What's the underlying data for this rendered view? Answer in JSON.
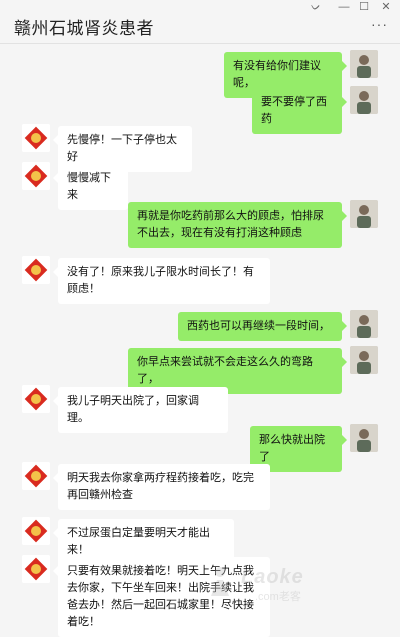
{
  "window": {
    "title": "赣州石城肾炎患者",
    "controls": {
      "pin": "ᨆ",
      "minimize": "—",
      "maximize": "☐",
      "close": "✕"
    },
    "more": "···"
  },
  "colors": {
    "self_bubble": "#95ec69",
    "other_bubble": "#ffffff",
    "background": "#f5f5f5"
  },
  "messages": [
    {
      "side": "right",
      "text": "有没有给你们建议呢，"
    },
    {
      "side": "right",
      "text": "要不要停了西药"
    },
    {
      "side": "left",
      "text": "先慢停！一下子停也太好"
    },
    {
      "side": "left",
      "text": "慢慢减下来"
    },
    {
      "side": "right",
      "text": "再就是你吃药前那么大的顾虑，怕排尿不出去，现在有没有打消这种顾虑"
    },
    {
      "side": "left",
      "text": "没有了！原来我儿子限水时间长了！有顾虑！"
    },
    {
      "side": "right",
      "text": "西药也可以再继续一段时间，"
    },
    {
      "side": "right",
      "text": "你早点来尝试就不会走这么久的弯路了，"
    },
    {
      "side": "left",
      "text": "我儿子明天出院了，回家调理。"
    },
    {
      "side": "right",
      "text": "那么快就出院了"
    },
    {
      "side": "left",
      "text": "明天我去你家拿两疗程药接着吃，吃完再回赣州检查"
    },
    {
      "side": "left",
      "text": "不过尿蛋白定量要明天才能出来！"
    },
    {
      "side": "left",
      "text": "只要有效果就接着吃！明天上午九点我去你家，下午坐车回来！出院手续让我爸去办！然后一起回石城家里！尽快接着吃！"
    }
  ],
  "watermark": {
    "text": "Laoke",
    "sub": ".com老客"
  }
}
